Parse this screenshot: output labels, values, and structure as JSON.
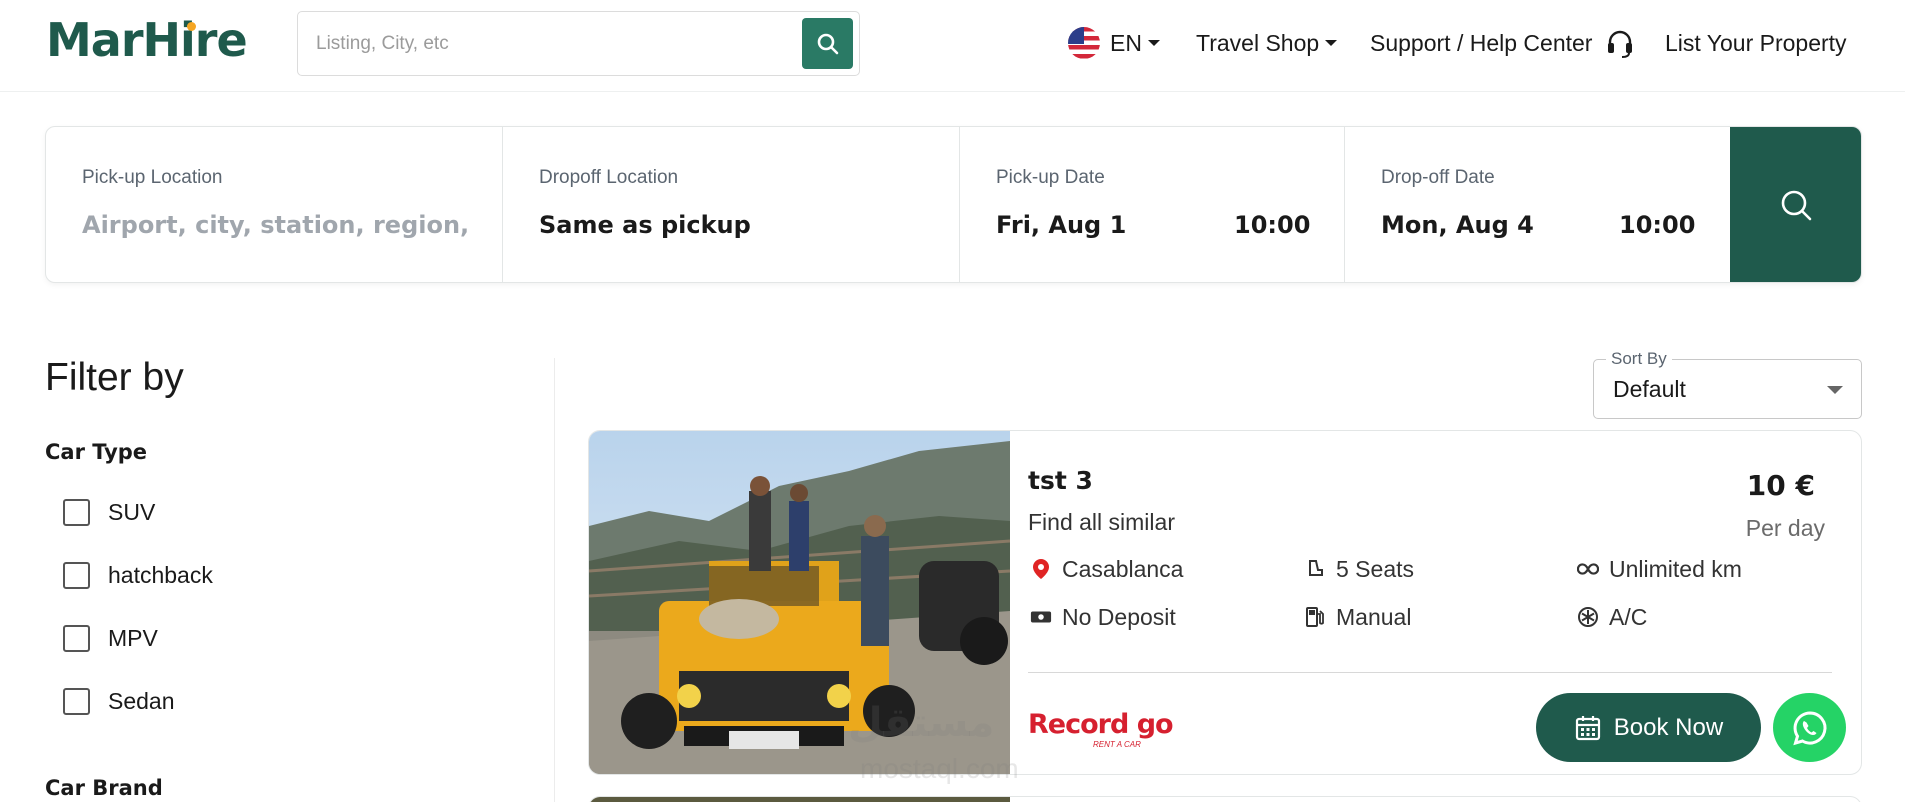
{
  "brand": {
    "name": "MarHire",
    "color": "#1f5a4c",
    "accent": "#f5a623"
  },
  "search": {
    "placeholder": "Listing, City, etc",
    "icon": "search-icon"
  },
  "nav": {
    "language": {
      "label": "EN",
      "icon": "us-flag-icon"
    },
    "travel_shop": "Travel Shop",
    "support": "Support / Help Center",
    "list_property": "List Your Property"
  },
  "booking": {
    "pickup": {
      "label": "Pick-up Location",
      "placeholder": "Airport, city, station, region, di"
    },
    "dropoff": {
      "label": "Dropoff Location",
      "value": "Same as pickup"
    },
    "pickup_date": {
      "label": "Pick-up Date",
      "date": "Fri, Aug 1",
      "time": "10:00"
    },
    "dropoff_date": {
      "label": "Drop-off Date",
      "date": "Mon, Aug 4",
      "time": "10:00"
    }
  },
  "filters": {
    "title": "Filter by",
    "car_type": {
      "title": "Car Type",
      "options": [
        "SUV",
        "hatchback",
        "MPV",
        "Sedan"
      ]
    },
    "car_brand": {
      "title": "Car Brand"
    }
  },
  "sort": {
    "label": "Sort By",
    "value": "Default"
  },
  "listing": {
    "name": "tst 3",
    "subtitle": "Find all similar",
    "price": "10 €",
    "price_unit": "Per day",
    "features": {
      "location": "Casablanca",
      "seats": "5 Seats",
      "mileage": "Unlimited km",
      "deposit": "No Deposit",
      "transmission": "Manual",
      "ac": "A/C"
    },
    "supplier": "Record go",
    "supplier_tagline": "RENT A CAR",
    "book_label": "Book Now"
  },
  "watermark": {
    "line1": "مستقل",
    "line2": "mostaql.com"
  }
}
